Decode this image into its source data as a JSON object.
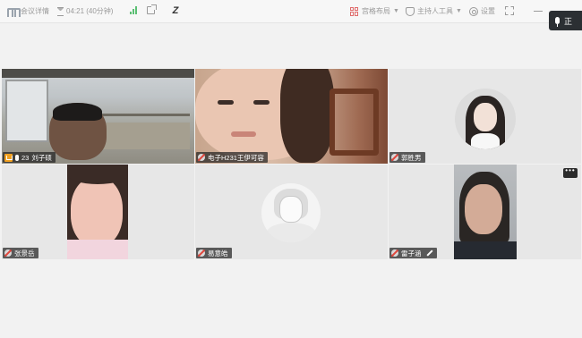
{
  "topbar": {
    "meeting_details": "会议详情",
    "timer": "04:21 (40分钟)",
    "layout_label": "宫格布局",
    "host_tools": "主持人工具",
    "settings": "设置"
  },
  "speaking": {
    "label": "正"
  },
  "tiles": [
    {
      "name": "刘子硕",
      "count": "23"
    },
    {
      "name": "电子H231王伊可容"
    },
    {
      "name": "郭胜男"
    },
    {
      "name": "张景岳"
    },
    {
      "name": "易意皓"
    },
    {
      "name": "雷子涵"
    }
  ],
  "more_button": "•••",
  "colors": {
    "active_border": "#3fae62",
    "background": "#f2f2f2",
    "name_tag_bg": "#232323"
  }
}
